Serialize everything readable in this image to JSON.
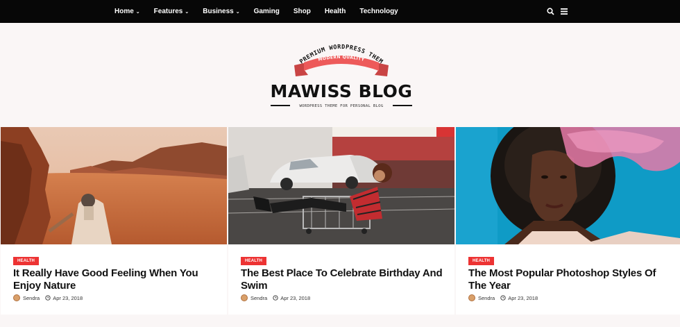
{
  "nav": {
    "items": [
      {
        "label": "Home",
        "has_dropdown": true
      },
      {
        "label": "Features",
        "has_dropdown": true
      },
      {
        "label": "Business",
        "has_dropdown": true
      },
      {
        "label": "Gaming",
        "has_dropdown": false
      },
      {
        "label": "Shop",
        "has_dropdown": false
      },
      {
        "label": "Health",
        "has_dropdown": false
      },
      {
        "label": "Technology",
        "has_dropdown": false
      }
    ],
    "caret": "⌄",
    "icons": [
      "search-icon",
      "menu-icon"
    ]
  },
  "logo": {
    "arc_text": "PREMIUM WORDPRESS THEM",
    "ribbon_text": "MODERN QUALITY",
    "name": "MAWISS BLOG",
    "tagline": "WORDPRESS THEME FOR PERSONAL BLOG",
    "ribbon_color": "#ed5a5a"
  },
  "posts": [
    {
      "category": "HEALTH",
      "title": "It Really Have Good Feeling When You Enjoy Nature",
      "author": "Sendra",
      "date": "Apr 23, 2018"
    },
    {
      "category": "HEALTH",
      "title": "The Best Place To Celebrate Birthday And Swim",
      "author": "Sendra",
      "date": "Apr 23, 2018"
    },
    {
      "category": "HEALTH",
      "title": "The Most Popular Photoshop Styles Of The Year",
      "author": "Sendra",
      "date": "Apr 23, 2018"
    }
  ],
  "colors": {
    "accent": "#ed3333",
    "nav_bg": "#070707",
    "page_bg": "#faf6f6"
  }
}
